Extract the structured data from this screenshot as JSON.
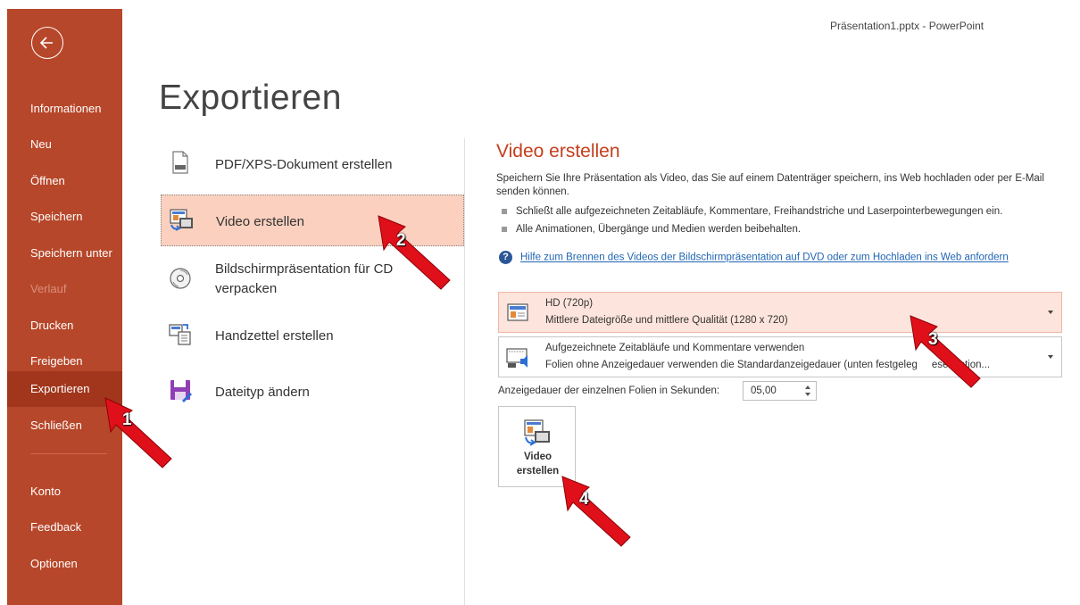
{
  "window": {
    "title": "Präsentation1.pptx  -  PowerPoint"
  },
  "sidebar": {
    "back_label": "Zurück",
    "items": [
      {
        "label": "Informationen"
      },
      {
        "label": "Neu"
      },
      {
        "label": "Öffnen"
      },
      {
        "label": "Speichern"
      },
      {
        "label": "Speichern unter"
      },
      {
        "label": "Verlauf"
      },
      {
        "label": "Drucken"
      },
      {
        "label": "Freigeben"
      },
      {
        "label": "Exportieren"
      },
      {
        "label": "Schließen"
      },
      {
        "label": "Konto"
      },
      {
        "label": "Feedback"
      },
      {
        "label": "Optionen"
      }
    ],
    "active": "Exportieren",
    "disabled": "Verlauf"
  },
  "main": {
    "title": "Exportieren",
    "options": [
      {
        "label": "PDF/XPS-Dokument erstellen",
        "icon": "pdf-document-icon"
      },
      {
        "label": "Video erstellen",
        "icon": "video-icon"
      },
      {
        "label_line1": "Bildschirmpräsentation für CD",
        "label_line2": "verpacken",
        "icon": "cd-icon"
      },
      {
        "label": "Handzettel erstellen",
        "icon": "handout-icon"
      },
      {
        "label": "Dateityp ändern",
        "icon": "save-as-icon"
      }
    ],
    "selected_option": "Video erstellen"
  },
  "pane": {
    "title": "Video erstellen",
    "description": "Speichern Sie Ihre Präsentation als Video, das Sie auf einem Datenträger speichern, ins Web hochladen oder per E-Mail senden können.",
    "bullets": [
      "Schließt alle aufgezeichneten Zeitabläufe, Kommentare, Freihandstriche und Laserpointerbewegungen ein.",
      "Alle Animationen, Übergänge und Medien werden beibehalten."
    ],
    "help_link": "Hilfe zum Brennen des Videos der Bildschirmpräsentation auf DVD oder zum Hochladen ins Web anfordern",
    "quality": {
      "line1": "HD (720p)",
      "line2": "Mittlere Dateigröße und mittlere Qualität (1280 x 720)"
    },
    "timings": {
      "line1": "Aufgezeichnete Zeitabläufe und Kommentare verwenden",
      "line2": "Folien ohne Anzeigedauer verwenden die Standardanzeigedauer (unten festgeleg",
      "line2_tail": "ese Option..."
    },
    "duration_label": "Anzeigedauer der einzelnen Folien in Sekunden:",
    "duration_value": "05,00",
    "create_button": {
      "line1": "Video",
      "line2": "erstellen"
    }
  },
  "annotations": [
    "1",
    "2",
    "3",
    "4"
  ],
  "colors": {
    "accent": "#b7472a",
    "accent_active": "#a1361c",
    "selection": "#fbd0bf",
    "title_red": "#c43e1c",
    "link": "#2166b3",
    "arrow": "#e0101a"
  }
}
